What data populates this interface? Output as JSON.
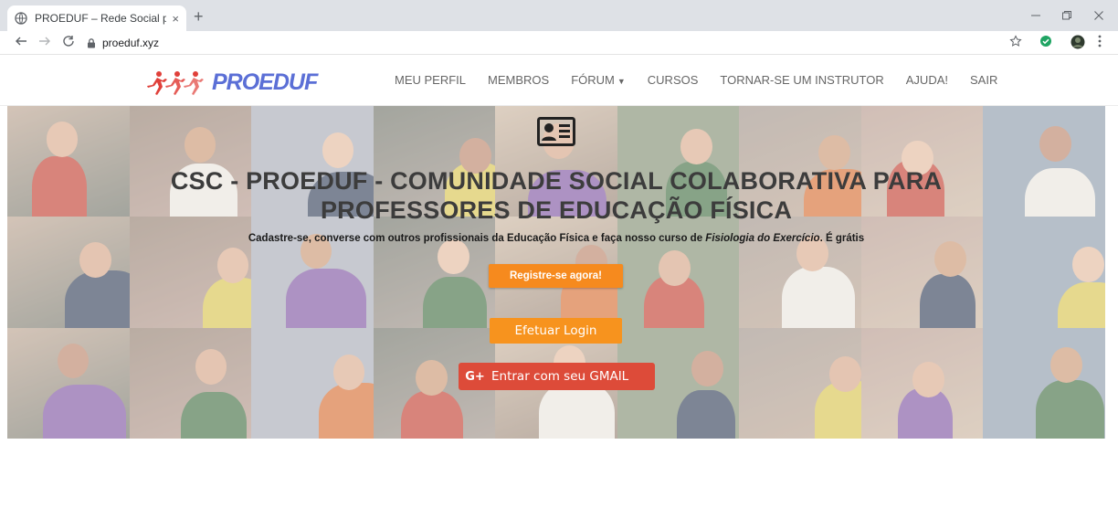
{
  "browser": {
    "tab_title": "PROEDUF – Rede Social para Pro",
    "tab_close": "×",
    "new_tab": "+",
    "url": "proeduf.xyz",
    "icons": [
      "back-icon",
      "forward-icon",
      "reload-icon",
      "lock-icon",
      "star-icon",
      "extension-check-icon",
      "profile-avatar-icon",
      "menu-icon"
    ]
  },
  "site": {
    "logo_text": "PROEDUF",
    "nav": [
      {
        "label": "MEU PERFIL"
      },
      {
        "label": "MEMBROS"
      },
      {
        "label": "FÓRUM"
      },
      {
        "label": "CURSOS"
      },
      {
        "label": "TORNAR-SE UM INSTRUTOR"
      },
      {
        "label": "AJUDA!"
      },
      {
        "label": "SAIR"
      }
    ]
  },
  "hero": {
    "title_line1": "CSC - PROEDUF - COMUNIDADE SOCIAL COLABORATIVA PARA",
    "title_line2": "PROFESSORES DE EDUCAÇÃO FÍSICA",
    "subtitle_a": "Cadastre-se, converse com outros profissionais da Educação Física e faça nosso curso de ",
    "subtitle_em": "Fisiologia do Exercício",
    "subtitle_b": ". É grátis",
    "register_label": "Registre-se agora!",
    "login_label": "Efetuar Login",
    "gmail_icon": "G+",
    "gmail_label": "Entrar com seu GMAIL"
  },
  "colors": {
    "register_button": "#f68a1e",
    "login_button": "#f7931e",
    "gmail_button": "#dd4b39",
    "logo": "#5b6fd6"
  }
}
